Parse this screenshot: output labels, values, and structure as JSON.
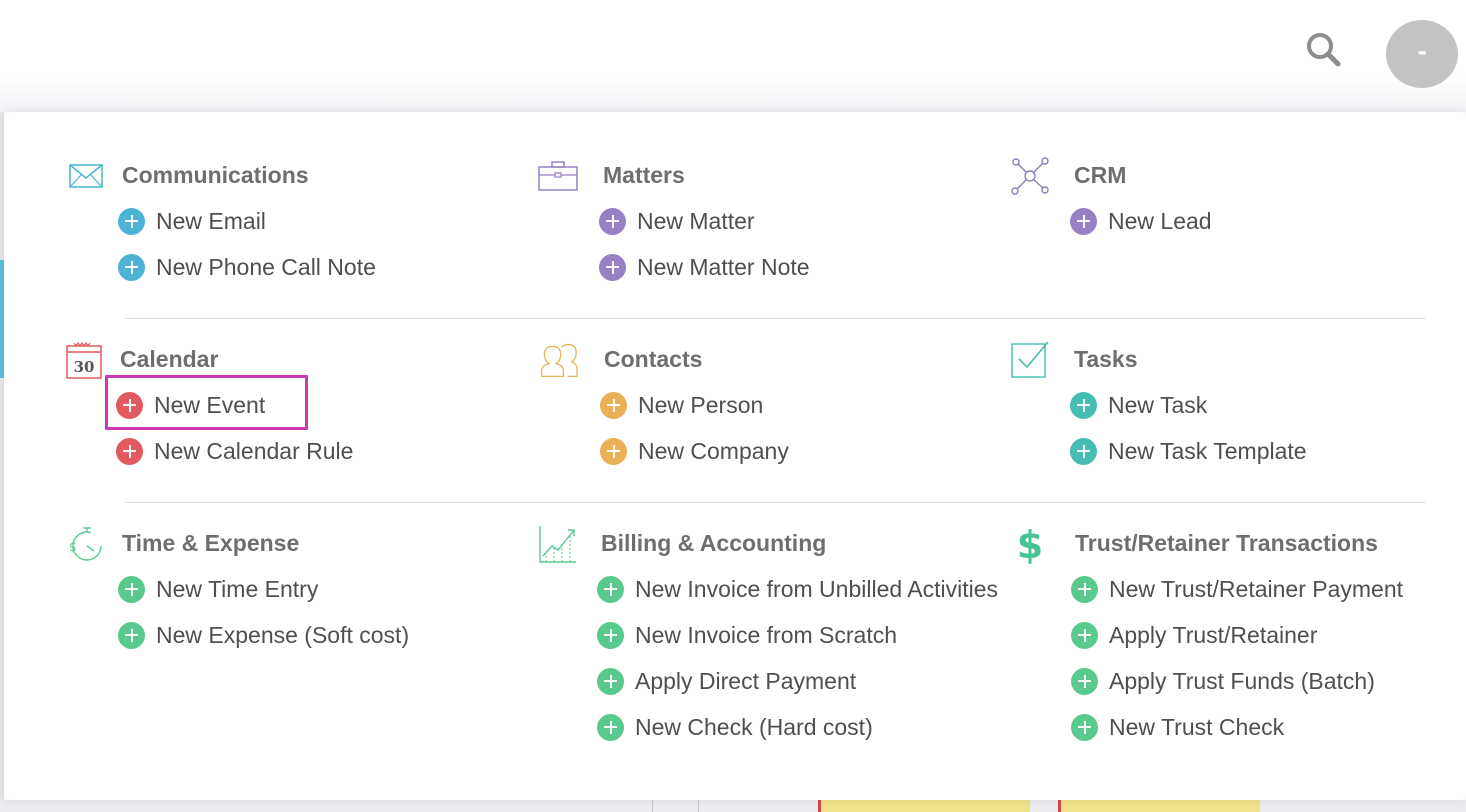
{
  "header": {
    "avatar_initial": "-"
  },
  "colors": {
    "communications": "#4cb3d4",
    "matters": "#9780c4",
    "crm": "#9780c4",
    "calendar": "#e15a5f",
    "contacts": "#eab055",
    "tasks": "#45bdb0",
    "time_expense": "#5ac98e",
    "billing": "#5ac98e",
    "trust": "#5ac98e",
    "highlight": "#c83cb6"
  },
  "sections": {
    "communications": {
      "title": "Communications",
      "icon": "envelope-icon",
      "items": [
        "New Email",
        "New Phone Call Note"
      ]
    },
    "matters": {
      "title": "Matters",
      "icon": "briefcase-icon",
      "items": [
        "New Matter",
        "New Matter Note"
      ]
    },
    "crm": {
      "title": "CRM",
      "icon": "network-icon",
      "items": [
        "New Lead"
      ]
    },
    "calendar": {
      "title": "Calendar",
      "icon": "calendar-icon",
      "icon_day": "30",
      "items": [
        "New Event",
        "New Calendar Rule"
      ]
    },
    "contacts": {
      "title": "Contacts",
      "icon": "people-icon",
      "items": [
        "New Person",
        "New Company"
      ]
    },
    "tasks": {
      "title": "Tasks",
      "icon": "checkbox-icon",
      "items": [
        "New Task",
        "New Task Template"
      ]
    },
    "time_expense": {
      "title": "Time & Expense",
      "icon": "stopwatch-icon",
      "items": [
        "New Time Entry",
        "New Expense (Soft cost)"
      ]
    },
    "billing": {
      "title": "Billing & Accounting",
      "icon": "chart-icon",
      "items": [
        "New Invoice from Unbilled Activities",
        "New Invoice from Scratch",
        "Apply Direct Payment",
        "New Check (Hard cost)"
      ]
    },
    "trust": {
      "title": "Trust/Retainer Transactions",
      "icon": "dollar-icon",
      "items": [
        "New Trust/Retainer Payment",
        "Apply Trust/Retainer",
        "Apply Trust Funds (Batch)",
        "New Trust Check"
      ]
    }
  }
}
